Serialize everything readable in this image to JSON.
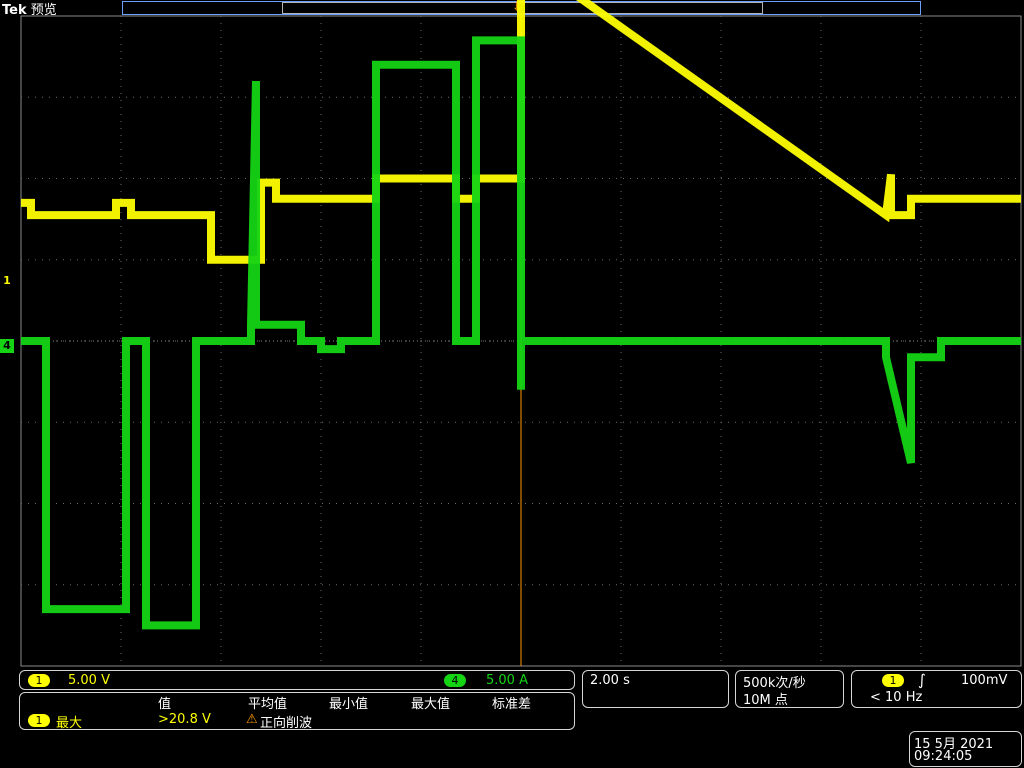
{
  "header": {
    "brand": "Tek",
    "mode": "预览"
  },
  "channels": {
    "ch1": {
      "marker": "1",
      "scale": "5.00 V",
      "color": "#ffff00"
    },
    "ch4": {
      "marker": "4",
      "scale": "5.00 A",
      "color": "#14d414"
    }
  },
  "timebase": {
    "scale": "2.00 s"
  },
  "acquisition": {
    "rate": "500k次/秒",
    "points": "10M 点"
  },
  "trigger": {
    "channel": "1",
    "level": "100mV",
    "freq": "< 10 Hz"
  },
  "measurements": {
    "headers": [
      "值",
      "平均值",
      "最小值",
      "最大值",
      "标准差"
    ],
    "row": {
      "channel": "1",
      "name": "最大",
      "value": ">20.8 V",
      "warning": "正向削波"
    }
  },
  "clock": {
    "date": "15 5月  2021",
    "time": "09:24:05"
  },
  "chart_data": {
    "type": "line",
    "xlabel": "",
    "ylabel": "",
    "grid": true,
    "xlim": [
      -10,
      10
    ],
    "ylim": [
      -4,
      4
    ],
    "x_unit": "s/div 2.00",
    "series": [
      {
        "name": "1",
        "color": "#ffff00",
        "points": [
          [
            -10.0,
            1.7
          ],
          [
            -9.8,
            1.7
          ],
          [
            -9.8,
            1.55
          ],
          [
            -8.1,
            1.55
          ],
          [
            -8.1,
            1.7
          ],
          [
            -7.8,
            1.7
          ],
          [
            -7.8,
            1.55
          ],
          [
            -6.2,
            1.55
          ],
          [
            -6.2,
            1.0
          ],
          [
            -5.2,
            1.0
          ],
          [
            -5.2,
            1.95
          ],
          [
            -4.9,
            1.95
          ],
          [
            -4.9,
            1.75
          ],
          [
            -2.9,
            1.75
          ],
          [
            -2.9,
            2.0
          ],
          [
            -1.3,
            2.0
          ],
          [
            -1.3,
            1.75
          ],
          [
            -0.9,
            1.75
          ],
          [
            -0.9,
            2.0
          ],
          [
            0.0,
            2.0
          ],
          [
            0.0,
            4.3
          ],
          [
            1.0,
            4.3
          ],
          [
            7.3,
            1.55
          ],
          [
            7.4,
            2.05
          ],
          [
            7.4,
            1.55
          ],
          [
            7.8,
            1.55
          ],
          [
            7.8,
            1.75
          ],
          [
            10.0,
            1.75
          ]
        ]
      },
      {
        "name": "4",
        "color": "#14d414",
        "points": [
          [
            -10.0,
            0.0
          ],
          [
            -9.5,
            0.0
          ],
          [
            -9.5,
            -3.3
          ],
          [
            -7.9,
            -3.3
          ],
          [
            -7.9,
            0.0
          ],
          [
            -7.5,
            0.0
          ],
          [
            -7.5,
            -3.5
          ],
          [
            -6.5,
            -3.5
          ],
          [
            -6.5,
            0.0
          ],
          [
            -5.4,
            0.0
          ],
          [
            -5.4,
            0.2
          ],
          [
            -5.3,
            3.2
          ],
          [
            -5.3,
            0.2
          ],
          [
            -4.4,
            0.2
          ],
          [
            -4.4,
            0.0
          ],
          [
            -4.0,
            0.0
          ],
          [
            -4.0,
            -0.1
          ],
          [
            -3.6,
            -0.1
          ],
          [
            -3.6,
            0.0
          ],
          [
            -2.9,
            0.0
          ],
          [
            -2.9,
            3.4
          ],
          [
            -1.3,
            3.4
          ],
          [
            -1.3,
            0.0
          ],
          [
            -0.9,
            0.0
          ],
          [
            -0.9,
            3.7
          ],
          [
            0.0,
            3.7
          ],
          [
            0.0,
            -0.6
          ],
          [
            0.0,
            0.0
          ],
          [
            7.3,
            0.0
          ],
          [
            7.3,
            -0.2
          ],
          [
            7.8,
            -1.5
          ],
          [
            7.8,
            -0.2
          ],
          [
            8.4,
            -0.2
          ],
          [
            8.4,
            0.0
          ],
          [
            10.0,
            0.0
          ]
        ]
      }
    ]
  }
}
